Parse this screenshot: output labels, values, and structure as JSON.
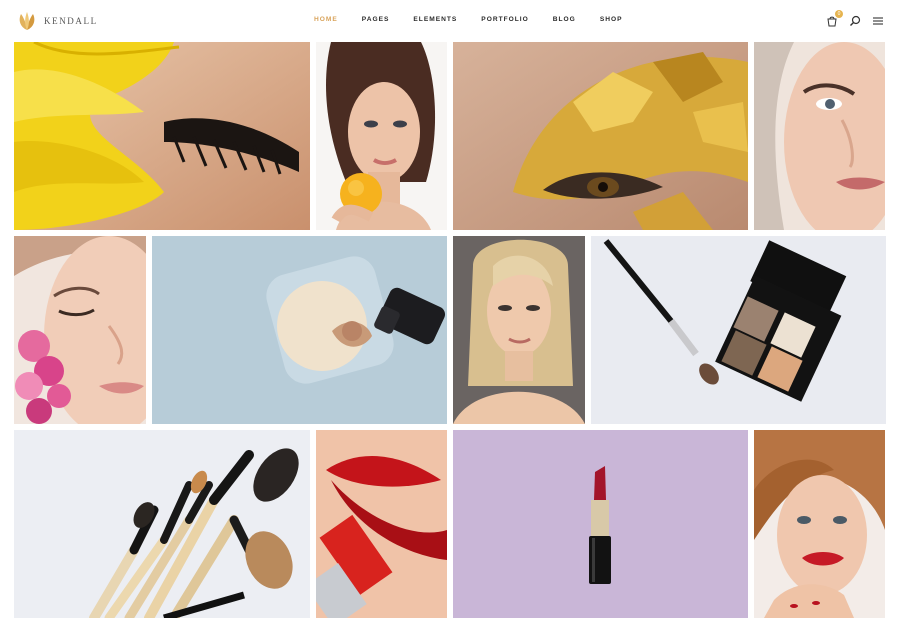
{
  "brand": {
    "name": "KENDALL",
    "accent": "#d9a45c"
  },
  "nav": [
    {
      "label": "HOME",
      "active": true
    },
    {
      "label": "PAGES"
    },
    {
      "label": "ELEMENTS"
    },
    {
      "label": "PORTFOLIO"
    },
    {
      "label": "BLOG"
    },
    {
      "label": "SHOP"
    }
  ],
  "tools": {
    "cart_count": "0",
    "cart_icon": "cart-icon",
    "search_icon": "search-icon",
    "menu_icon": "menu-icon"
  },
  "gallery": [
    {
      "subject": "eyelash-flower"
    },
    {
      "subject": "woman-orange"
    },
    {
      "subject": "gold-eye"
    },
    {
      "subject": "face-closeup"
    },
    {
      "subject": "face-flowers"
    },
    {
      "subject": "powder-puff"
    },
    {
      "subject": "blonde-woman"
    },
    {
      "subject": "brush-palette"
    },
    {
      "subject": "brush-set"
    },
    {
      "subject": "red-lips"
    },
    {
      "subject": "lipstick-lilac"
    },
    {
      "subject": "woman-red-lips"
    }
  ]
}
